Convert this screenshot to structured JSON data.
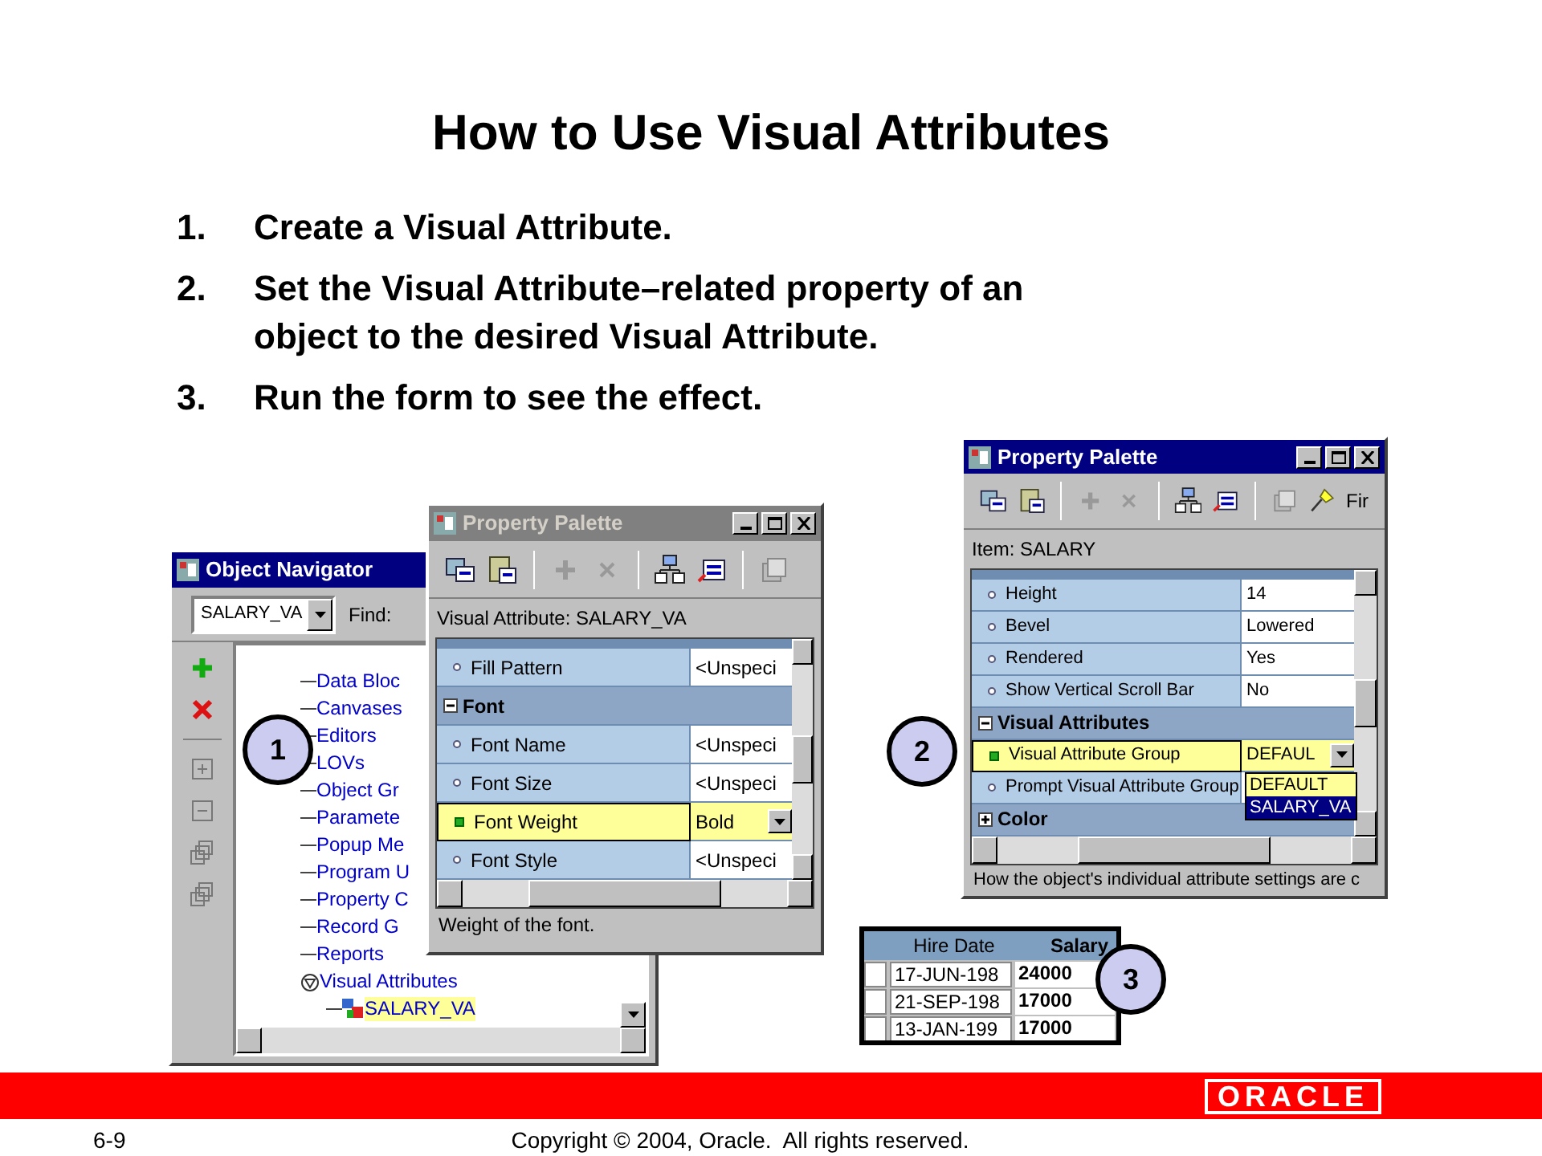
{
  "slide": {
    "title": "How to Use Visual Attributes",
    "steps": [
      {
        "number": "1.",
        "text": "Create a Visual Attribute."
      },
      {
        "number": "2.",
        "text": "Set the Visual Attribute–related property of an object to the desired Visual Attribute."
      },
      {
        "number": "3.",
        "text": "Run the form to see the effect."
      }
    ]
  },
  "object_navigator": {
    "title": "Object Navigator",
    "active": true,
    "module": "SALARY_VA",
    "find_label": "Find:",
    "tree": [
      {
        "label": "Data Bloc"
      },
      {
        "label": "Canvases"
      },
      {
        "label": "Editors"
      },
      {
        "label": "LOVs"
      },
      {
        "label": "Object Gr"
      },
      {
        "label": "Paramete"
      },
      {
        "label": "Popup Me"
      },
      {
        "label": "Program U"
      },
      {
        "label": "Property C"
      },
      {
        "label": "Record G"
      },
      {
        "label": "Reports"
      },
      {
        "label": "Visual Attributes",
        "expanded": true,
        "children": [
          {
            "label": "SALARY_VA",
            "selected": true
          }
        ]
      }
    ]
  },
  "palette_1": {
    "title": "Property Palette",
    "active": false,
    "context": "Visual Attribute: SALARY_VA",
    "rows": [
      {
        "kind": "property",
        "name": "Fill Pattern",
        "value": "<Unspeci",
        "selected": false
      },
      {
        "kind": "group",
        "name": "Font",
        "expanded": true
      },
      {
        "kind": "property",
        "name": "Font Name",
        "value": "<Unspeci",
        "selected": false
      },
      {
        "kind": "property",
        "name": "Font Size",
        "value": "<Unspeci",
        "selected": false
      },
      {
        "kind": "property",
        "name": "Font Weight",
        "value": "Bold",
        "selected": true
      },
      {
        "kind": "property",
        "name": "Font Style",
        "value": "<Unspeci",
        "selected": false
      }
    ],
    "hint": "Weight of the font."
  },
  "palette_2": {
    "title": "Property Palette",
    "active": true,
    "toolbar_text": "Fir",
    "context": "Item: SALARY",
    "rows": [
      {
        "kind": "property",
        "name": "Height",
        "value": "14",
        "selected": false
      },
      {
        "kind": "property",
        "name": "Bevel",
        "value": "Lowered",
        "selected": false
      },
      {
        "kind": "property",
        "name": "Rendered",
        "value": "Yes",
        "selected": false
      },
      {
        "kind": "property",
        "name": "Show Vertical Scroll Bar",
        "value": "No",
        "selected": false
      },
      {
        "kind": "group",
        "name": "Visual Attributes",
        "expanded": true
      },
      {
        "kind": "property",
        "name": "Visual Attribute Group",
        "value": "DEFAUL",
        "selected": true,
        "options": [
          {
            "label": "DEFAULT",
            "selected": false
          },
          {
            "label": "SALARY_VA",
            "selected": true
          }
        ]
      },
      {
        "kind": "property",
        "name": "Prompt Visual Attribute Group",
        "value": "",
        "selected": false
      },
      {
        "kind": "group",
        "name": "Color",
        "expanded": false
      }
    ],
    "hint": "How the object's individual attribute settings are c"
  },
  "result_table": {
    "columns": [
      "Hire Date",
      "Salary"
    ],
    "rows": [
      [
        "17-JUN-198",
        "24000"
      ],
      [
        "21-SEP-198",
        "17000"
      ],
      [
        "13-JAN-199",
        "17000"
      ]
    ]
  },
  "callouts": [
    "1",
    "2",
    "3"
  ],
  "footer": {
    "page": "6-9",
    "copyright": "Copyright © 2004, Oracle.  All rights reserved.",
    "logo": "ORACLE"
  }
}
